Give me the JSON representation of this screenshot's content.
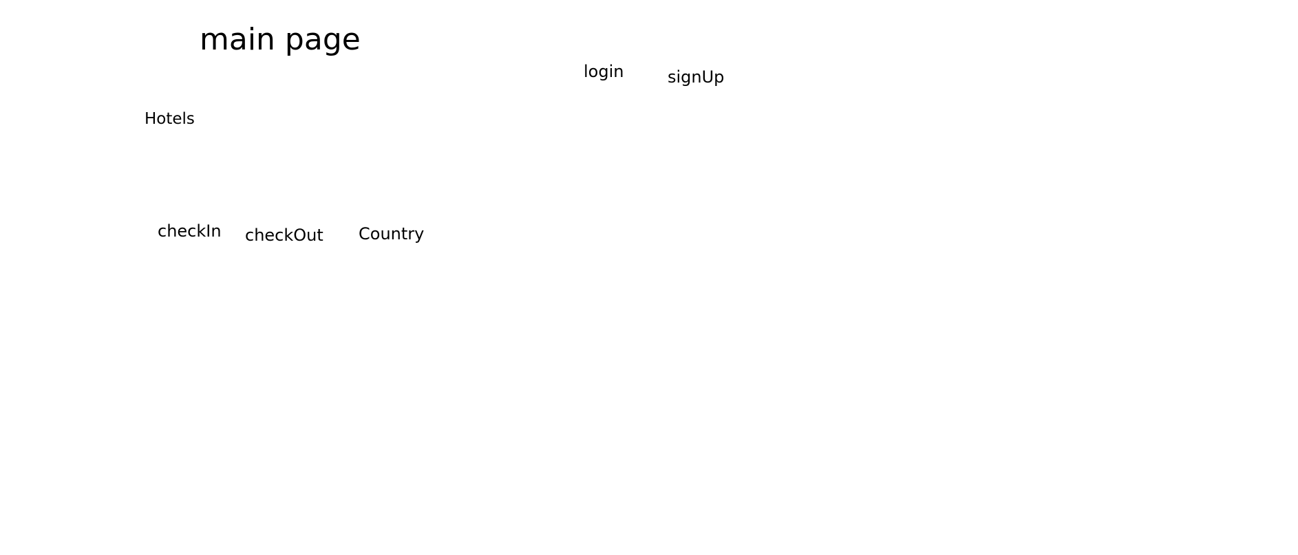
{
  "header": {
    "title": "main page",
    "login_label": "login",
    "signup_label": "signUp"
  },
  "main": {
    "section_label": "Hotels",
    "filters": {
      "checkin_label": "checkIn",
      "checkout_label": "checkOut",
      "country_label": "Country"
    }
  }
}
